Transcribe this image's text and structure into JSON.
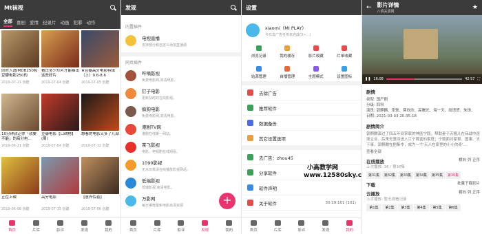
{
  "home": {
    "title": "Mt袜视",
    "categories": [
      "全部",
      "喜剧",
      "爱情",
      "纪录片",
      "动画",
      "犯罪",
      "动作"
    ],
    "cards": [
      {
        "title": "同时入选IMDB250和豆瓣电影250的",
        "date": "2019-07-21 创建"
      },
      {
        "title": "看过多少烂片才能拍出这些好片",
        "date": "2019-07-04 创建"
      },
      {
        "title": "★豆瓣高分电影特辑（上）9.6-8.6",
        "date": "2019-07-05 创建"
      },
      {
        "title": "10分钟就让你「就要不能」的高分电...",
        "date": "2019-06-21 创建"
      },
      {
        "title": "豆瓣电影【口碑榜】(周)",
        "date": "2019-07-04 创建"
      },
      {
        "title": "想看的电影又多了几部",
        "date": "2019-07-12 创建"
      },
      {
        "title": "正在上映",
        "date": "2019-06-08 创建"
      },
      {
        "title": "高分电影",
        "date": "2019-07-15 创建"
      },
      {
        "title": "【意外惊喜】",
        "date": "2019-07-06 创建"
      }
    ],
    "durations": [
      "",
      "",
      "",
      "",
      "",
      "",
      "",
      "",
      ""
    ],
    "tabs": [
      "首页",
      "片库",
      "影评",
      "发现",
      "我的"
    ]
  },
  "discover": {
    "title": "发现",
    "section1": "内置插件",
    "builtin": {
      "name": "电视直播",
      "desc": "支持部分和自定义添加直播源"
    },
    "section2": "网页插件",
    "plugins": [
      {
        "name": "哔嘀影视",
        "desc": "免费电影网,高清电影。"
      },
      {
        "name": "钉子电影",
        "desc": "更新及时的在线影视。"
      },
      {
        "name": "疯狗电影",
        "desc": "免费电影网,高清电影。"
      },
      {
        "name": "港剧TV网",
        "desc": "港剧在线第一网站。"
      },
      {
        "name": "茶飞影视",
        "desc": "电影、电视剧在线观看。"
      },
      {
        "name": "1090影视",
        "desc": "无水印高清在线播放影视网站。"
      },
      {
        "name": "低端影视",
        "desc": "低端影视,高清电影。"
      },
      {
        "name": "万影网",
        "desc": "每天推荐最新电影高清资源"
      }
    ],
    "fab": "+"
  },
  "settings": {
    "title": "设置",
    "user": "xiaomi（MI PLAY）",
    "sub": "今日去广告任务未完成(3>...)",
    "grid1": [
      "浏览记录",
      "我的缓存",
      "影片收藏",
      "片单收藏"
    ],
    "grid2": [
      "站源管理",
      "自播管理",
      "主题模式",
      "设置图标"
    ],
    "items": [
      "去除广告",
      "推荐软件",
      "数据备份",
      "其它设置选项"
    ],
    "items2": [
      {
        "label": "去广告：zhou45",
        "value": ""
      },
      {
        "label": "分享软件",
        "value": ""
      },
      {
        "label": "软件声明",
        "value": ""
      },
      {
        "label": "关于软件",
        "value": "30.19.101 (101)"
      }
    ],
    "watermark1": "小高教学网",
    "watermark2": "www.12580sky.com"
  },
  "detail": {
    "title": "影片详情",
    "subtitle": "八佰关源网",
    "time_cur": "16:08",
    "time_total": "42:57",
    "info_head": "剧情",
    "info": [
      "类型: 国产剧",
      "分级: 四科",
      "演员: 郭麒麟、宋轶、蒋欣欣、高曙光、海一天、尚语贤、朱珠、刘...",
      "日期: 2021-03-03 20:35:18"
    ],
    "plot_head": "剧情简介",
    "plot": "郭麒麟演过了四五年间掌家的神医宁毅，帮助妻子苏檀儿在商战中逐渐立业，后来无意间进入江宁首富的家庭；宁毅面对家事、国事、天下事，郭麒麟在剧集中，成为一个'天人在家里的小小的奇'...",
    "more": "查看全部",
    "play1": "在线播放",
    "play1_sub": "上次播放: 36 / 第36集",
    "play1_right": "横向  列  正序",
    "eps1": [
      "第31集",
      "第32集",
      "第33集",
      "第34集",
      "第35集",
      "第36集"
    ],
    "dl": "下载",
    "dl_sub": "批量下载影片",
    "play2": "云播放",
    "play2_sub": "上次播放: 暂无观看记录",
    "play2_right": "横向  列  正序",
    "eps2": [
      "第1集",
      "第2集",
      "第3集",
      "第4集",
      "第5集",
      "第6集"
    ]
  }
}
